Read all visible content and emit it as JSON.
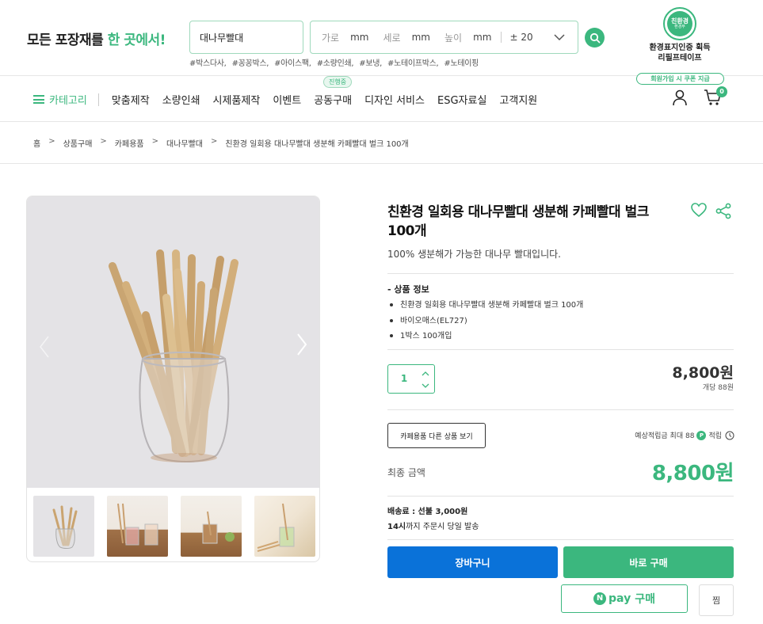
{
  "header": {
    "tagline_prefix": "모든 포장재를 ",
    "tagline_highlight": "한 곳에서!",
    "search_value": "대나무빨대",
    "size_filter": {
      "width_label": "가로",
      "width_unit": "mm",
      "length_label": "세로",
      "length_unit": "mm",
      "height_label": "높이",
      "height_unit": "mm",
      "tolerance": "± 20"
    },
    "hashtags": [
      "#박스다사,",
      "#꽁꽁박스,",
      "#아이스팩,",
      "#소량인쇄,",
      "#보냉,",
      "#노테이프박스,",
      "#노테이핑"
    ],
    "cert_logo_text": "친환경",
    "cert_logo_sub": "환경부",
    "cert_text_line1": "환경표지인증 획득",
    "cert_text_line2": "리필프테이프"
  },
  "nav": {
    "category": "카테고리",
    "items": [
      "맞춤제작",
      "소량인쇄",
      "시제품제작",
      "이벤트",
      "공동구매",
      "디자인 서비스",
      "ESG자료실",
      "고객지원"
    ],
    "ongoing_badge": "진행중",
    "coupon_pill": "회원가입 시 쿠폰 지급",
    "cart_count": "0"
  },
  "breadcrumb": [
    "홈",
    "상품구매",
    "카페용품",
    "대나무빨대",
    "친환경 일회용 대나무빨대 생분해 카페빨대 벌크 100개"
  ],
  "product": {
    "title": "친환경 일회용 대나무빨대 생분해 카페빨대 벌크 100개",
    "subtitle": "100% 생분해가 가능한 대나무 빨대입니다.",
    "info_heading": "- 상품 정보",
    "info_items": [
      "친환경 일회용 대나무빨대 생분해 카페빨대 벌크 100개",
      "바이오매스(EL727)",
      "1박스 100개입"
    ],
    "quantity": "1",
    "price": "8,800원",
    "unit_price": "개당 88원",
    "other_products_button": "카페용품 다른 상품 보기",
    "points_prefix": "예상적립금 최대 88",
    "points_badge": "P",
    "points_suffix": "적립",
    "final_label": "최종 금액",
    "final_price": "8,800원",
    "shipping_fee": "배송료 : 선불 3,000원",
    "dispatch_bold": "14시",
    "dispatch_rest": "까지 주문시 당일 발송",
    "cart_button": "장바구니",
    "buy_button": "바로 구매",
    "npay_n": "N",
    "npay_pay": "pay",
    "npay_buy": "구매",
    "wish_button": "찜"
  },
  "colors": {
    "brand_green": "#3bb77e",
    "cart_blue": "#0a72d9"
  },
  "icons": [
    "search-icon",
    "chevron-down-icon",
    "menu-icon",
    "user-icon",
    "cart-icon",
    "heart-icon",
    "share-icon",
    "arrow-left-icon",
    "arrow-right-icon",
    "clock-icon"
  ]
}
